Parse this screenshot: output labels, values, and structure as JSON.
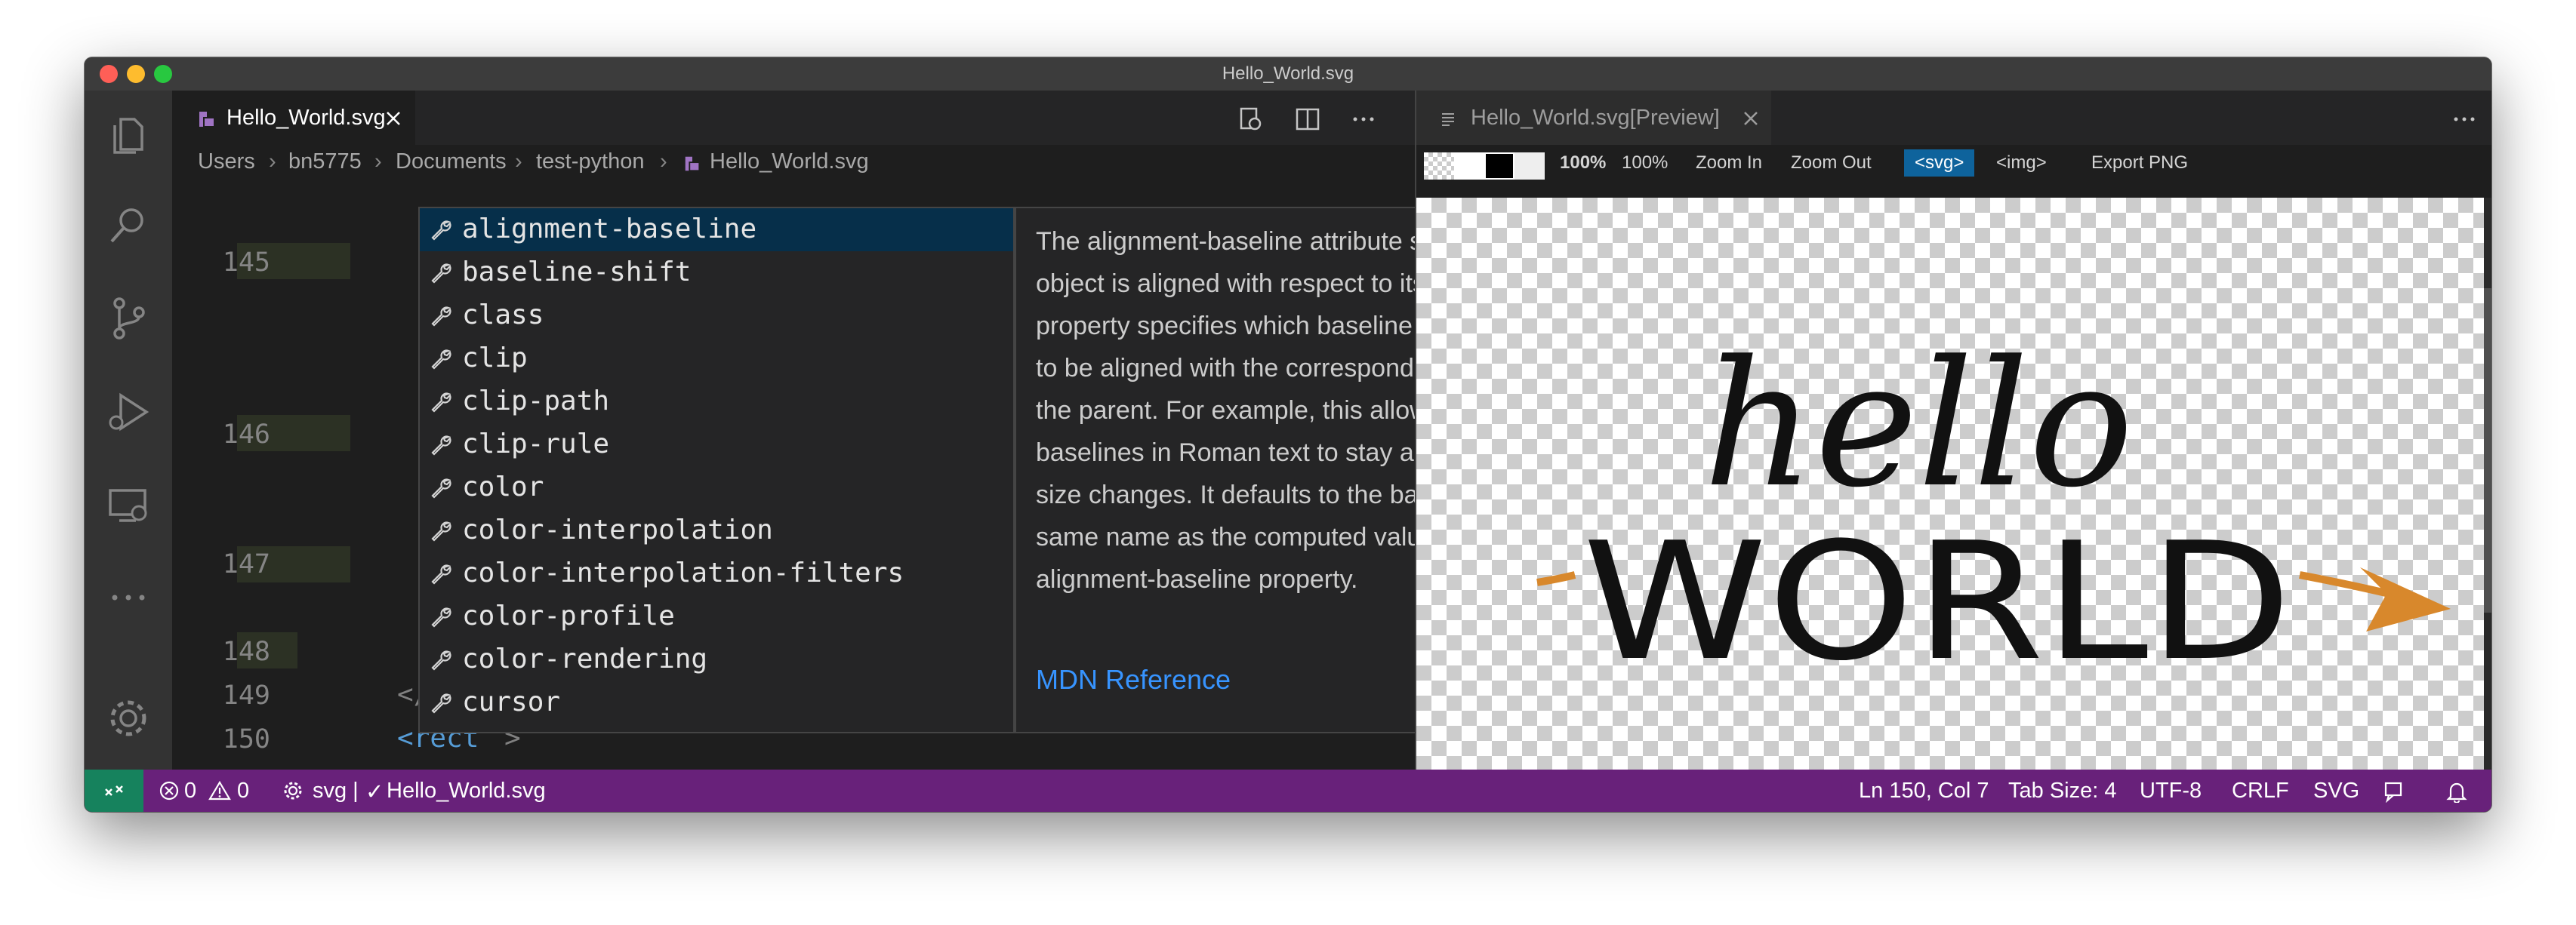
{
  "window": {
    "title": "Hello_World.svg"
  },
  "activity_bar": {
    "icons": [
      "files-icon",
      "search-icon",
      "source-control-icon",
      "run-debug-icon",
      "remote-explorer-icon",
      "more-icon",
      "settings-gear-icon"
    ]
  },
  "editor": {
    "tab": {
      "label": "Hello_World.svg"
    },
    "breadcrumb": [
      "Users",
      "bn5775",
      "Documents",
      "test-python",
      "Hello_World.svg"
    ],
    "line_numbers": [
      "145",
      "146",
      "147",
      "148",
      "149",
      "150"
    ],
    "code_lines": {
      "line_148_tag": "</",
      "line_149_tag": "</g>",
      "line_150_tag": "<rect",
      "line_150_cursor": ">"
    },
    "suggestions": [
      "alignment-baseline",
      "baseline-shift",
      "class",
      "clip",
      "clip-path",
      "clip-rule",
      "color",
      "color-interpolation",
      "color-interpolation-filters",
      "color-profile",
      "color-rendering",
      "cursor"
    ],
    "selected_suggestion": 0,
    "details": {
      "description": "The alignment-baseline attribute specifies how an object is aligned with respect to its parent. This property specifies which baseline of this element is to be aligned with the corresponding baseline of the parent. For example, this allows alphabetic baselines in Roman text to stay aligned across font size changes. It defaults to the baseline with the same name as the computed value of the alignment-baseline property.",
      "link": "MDN Reference",
      "close": "×"
    }
  },
  "preview": {
    "tab_label": "Hello_World.svg[Preview]",
    "toolbar": {
      "zoom_display": "100%",
      "zoom_100": "100%",
      "zoom_in": "Zoom In",
      "zoom_out": "Zoom Out",
      "svg_button": "<svg>",
      "img_button": "<img>",
      "export": "Export PNG"
    },
    "image_words": [
      "hello",
      "WORLD"
    ]
  },
  "status_bar": {
    "errors": "0",
    "warnings": "0",
    "language_item": "svg |",
    "file_item": "Hello_World.svg",
    "position": "Ln 150, Col 7",
    "tab_size": "Tab Size: 4",
    "encoding": "UTF-8",
    "eol": "CRLF",
    "language": "SVG"
  },
  "colors": {
    "status_bar": "#68217a",
    "editor_bg": "#1e1e1e",
    "selection": "#062f4a",
    "link": "#3794ff",
    "arrow": "#d8882c"
  }
}
